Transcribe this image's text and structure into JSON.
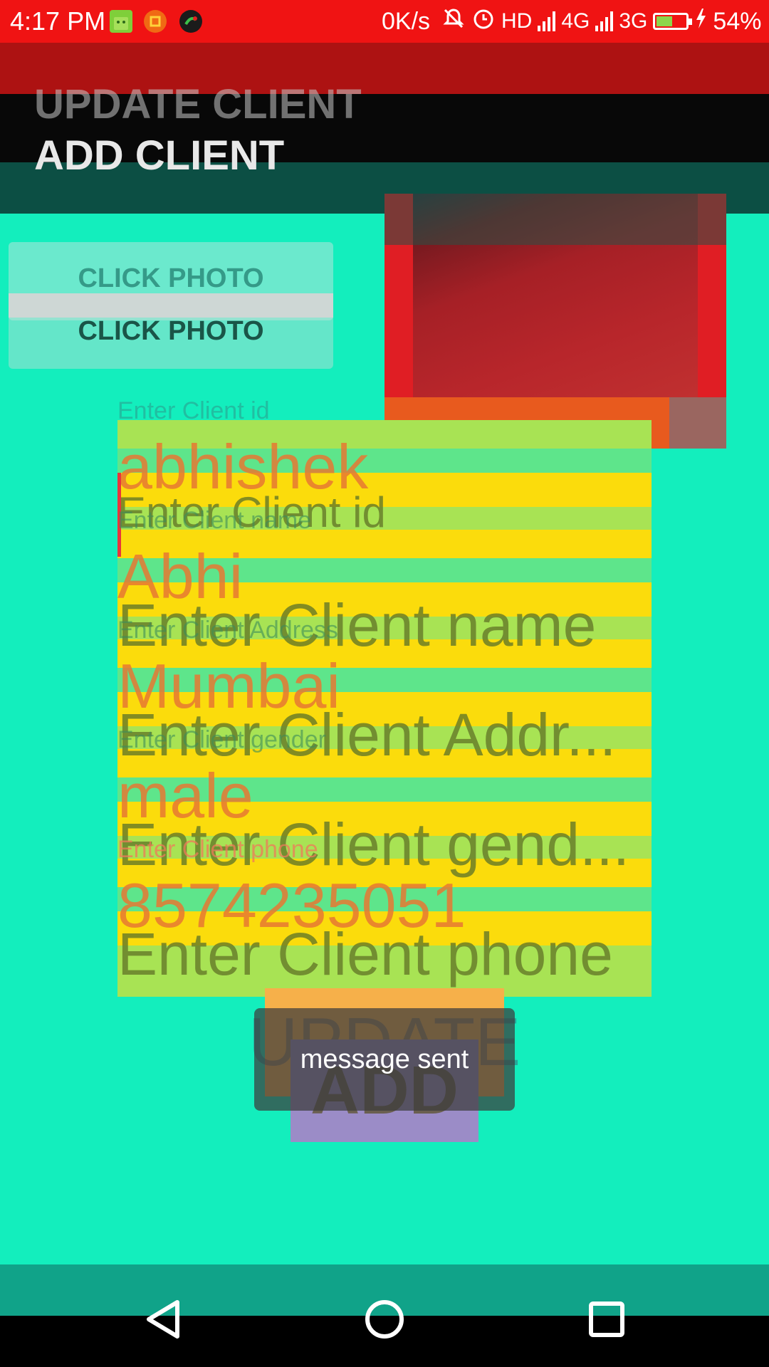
{
  "status_bar": {
    "time": "4:17 PM",
    "net_speed": "0K/s",
    "hd_label": "HD",
    "net_4g": "4G",
    "net_3g": "3G",
    "battery_percent": "54%",
    "battery_level": 0.54,
    "bar_color": "#f01313"
  },
  "toolbar": {
    "update_title": "UPDATE CLIENT",
    "add_title": "ADD CLIENT"
  },
  "photo_buttons": {
    "first_label": "CLICK PHOTO",
    "second_label": "CLICK PHOTO"
  },
  "form": {
    "id_hint_small": "Enter Client id",
    "id_value": "abhishek",
    "id_hint_large": "Enter Client id",
    "name_hint_small": "Enter Client name",
    "name_value": "Abhi",
    "name_hint_large": "Enter Client name",
    "address_hint_small": "Enter Client Address",
    "address_value": "Mumbai",
    "address_hint_large": "Enter Client Addr...",
    "gender_hint_small": "Enter Client gender",
    "gender_value": "male",
    "gender_hint_large": "Enter Client gend...",
    "phone_hint_small": "Enter Client phone",
    "phone_value": "8574235051",
    "phone_hint_large": "Enter Client phone"
  },
  "actions": {
    "update_label": "UPDATE",
    "add_label": "ADD"
  },
  "toast": {
    "message": "message sent"
  },
  "colors": {
    "background": "#13eebd",
    "toolbar_dark": "#080808",
    "form_yellow": "#fbdc0c",
    "form_green": "#5ee58b"
  }
}
